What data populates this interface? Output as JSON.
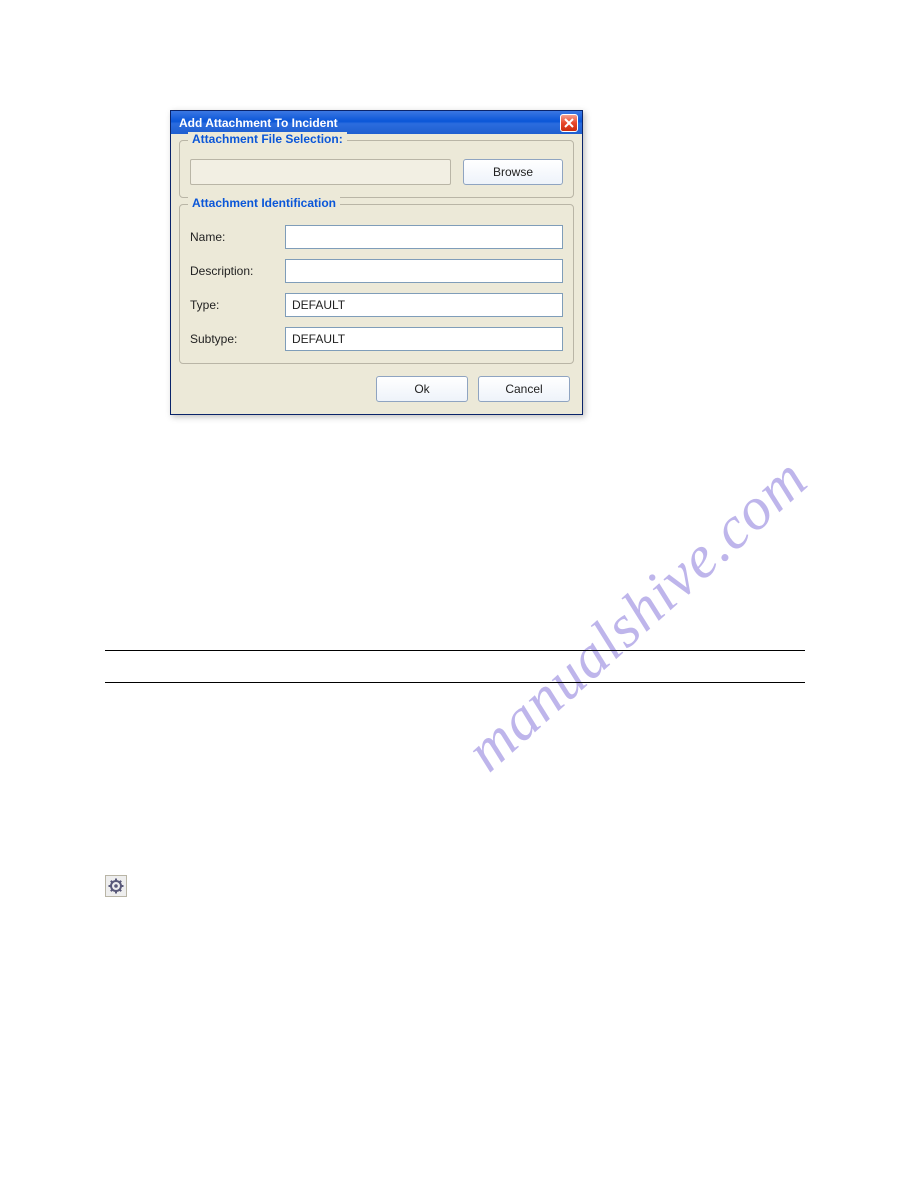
{
  "dialog": {
    "title": "Add Attachment To Incident",
    "section1": {
      "legend": "Attachment File Selection:",
      "browse_label": "Browse",
      "file_value": ""
    },
    "section2": {
      "legend": "Attachment Identification",
      "rows": {
        "name": {
          "label": "Name:",
          "value": ""
        },
        "description": {
          "label": "Description:",
          "value": ""
        },
        "type": {
          "label": "Type:",
          "value": "DEFAULT"
        },
        "subtype": {
          "label": "Subtype:",
          "value": "DEFAULT"
        }
      }
    },
    "buttons": {
      "ok": "Ok",
      "cancel": "Cancel"
    }
  },
  "watermark": "manualshive.com"
}
